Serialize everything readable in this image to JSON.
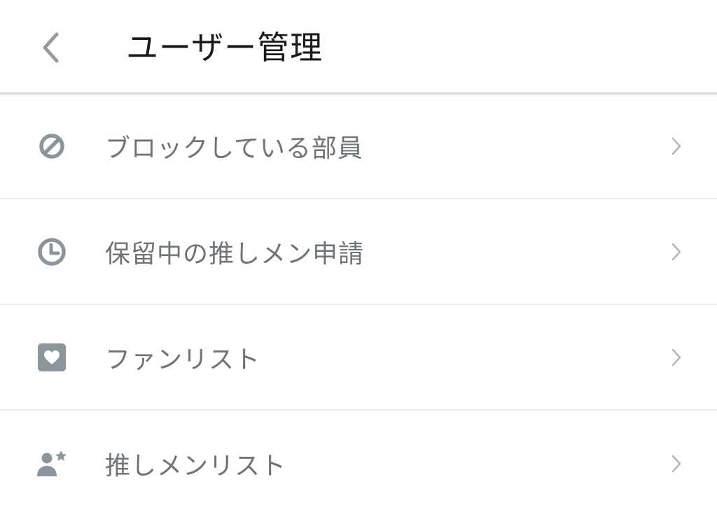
{
  "header": {
    "title": "ユーザー管理",
    "back_icon": "chevron-left-icon"
  },
  "menu": {
    "items": [
      {
        "label": "ブロックしている部員",
        "icon": "block-icon"
      },
      {
        "label": "保留中の推しメン申請",
        "icon": "clock-icon"
      },
      {
        "label": "ファンリスト",
        "icon": "heart-box-icon"
      },
      {
        "label": "推しメンリスト",
        "icon": "person-star-icon"
      }
    ]
  },
  "colors": {
    "icon": "#8a969c",
    "label": "#6f7478",
    "title": "#1a1a1a",
    "chevron": "#b5b5b5",
    "back": "#9a9a9a",
    "divider": "#ececec"
  }
}
